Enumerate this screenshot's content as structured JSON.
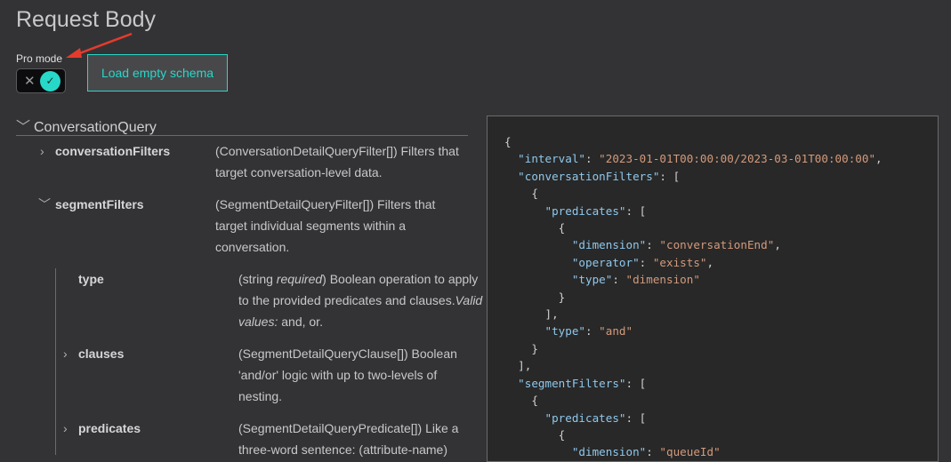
{
  "title": "Request Body",
  "pro_mode": {
    "label": "Pro mode",
    "enabled": true
  },
  "load_button": "Load empty schema",
  "colors": {
    "accent": "#27d8c8",
    "annotation_arrow": "#e53b2c"
  },
  "tree": {
    "root": "ConversationQuery",
    "rows": [
      {
        "name": "conversationFilters",
        "expanded": false,
        "desc": "(ConversationDetailQueryFilter[]) Filters that target conversation-level data."
      },
      {
        "name": "segmentFilters",
        "expanded": true,
        "desc": "(SegmentDetailQueryFilter[]) Filters that target individual segments within a conversation."
      }
    ],
    "children": [
      {
        "name": "type",
        "desc_pre": "(string ",
        "desc_em": "required",
        "desc_mid": ") Boolean operation to apply to the provided predicates and clauses.",
        "desc_em2": "Valid values:",
        "desc_post": " and, or."
      },
      {
        "name": "clauses",
        "desc": "(SegmentDetailQueryClause[]) Boolean 'and/or' logic with up to two-levels of nesting."
      },
      {
        "name": "predicates",
        "desc": "(SegmentDetailQueryPredicate[]) Like a three-word sentence: (attribute-name)"
      }
    ]
  },
  "code_lines": [
    {
      "i": 0,
      "t": [
        [
          "p",
          "{"
        ]
      ]
    },
    {
      "i": 1,
      "t": [
        [
          "k",
          "\"interval\""
        ],
        [
          "p",
          ": "
        ],
        [
          "s",
          "\"2023-01-01T00:00:00/2023-03-01T00:00:00\""
        ],
        [
          "p",
          ","
        ]
      ]
    },
    {
      "i": 1,
      "t": [
        [
          "k",
          "\"conversationFilters\""
        ],
        [
          "p",
          ": ["
        ]
      ]
    },
    {
      "i": 2,
      "t": [
        [
          "p",
          "{"
        ]
      ]
    },
    {
      "i": 3,
      "t": [
        [
          "k",
          "\"predicates\""
        ],
        [
          "p",
          ": ["
        ]
      ]
    },
    {
      "i": 4,
      "t": [
        [
          "p",
          "{"
        ]
      ]
    },
    {
      "i": 5,
      "t": [
        [
          "k",
          "\"dimension\""
        ],
        [
          "p",
          ": "
        ],
        [
          "s",
          "\"conversationEnd\""
        ],
        [
          "p",
          ","
        ]
      ]
    },
    {
      "i": 5,
      "t": [
        [
          "k",
          "\"operator\""
        ],
        [
          "p",
          ": "
        ],
        [
          "s",
          "\"exists\""
        ],
        [
          "p",
          ","
        ]
      ]
    },
    {
      "i": 5,
      "t": [
        [
          "k",
          "\"type\""
        ],
        [
          "p",
          ": "
        ],
        [
          "s",
          "\"dimension\""
        ]
      ]
    },
    {
      "i": 4,
      "t": [
        [
          "p",
          "}"
        ]
      ]
    },
    {
      "i": 3,
      "t": [
        [
          "p",
          "],"
        ]
      ]
    },
    {
      "i": 3,
      "t": [
        [
          "k",
          "\"type\""
        ],
        [
          "p",
          ": "
        ],
        [
          "s",
          "\"and\""
        ]
      ]
    },
    {
      "i": 2,
      "t": [
        [
          "p",
          "}"
        ]
      ]
    },
    {
      "i": 1,
      "t": [
        [
          "p",
          "],"
        ]
      ]
    },
    {
      "i": 1,
      "t": [
        [
          "k",
          "\"segmentFilters\""
        ],
        [
          "p",
          ": ["
        ]
      ]
    },
    {
      "i": 2,
      "t": [
        [
          "p",
          "{"
        ]
      ]
    },
    {
      "i": 3,
      "t": [
        [
          "k",
          "\"predicates\""
        ],
        [
          "p",
          ": ["
        ]
      ]
    },
    {
      "i": 4,
      "t": [
        [
          "p",
          "{"
        ]
      ]
    },
    {
      "i": 5,
      "t": [
        [
          "k",
          "\"dimension\""
        ],
        [
          "p",
          ": "
        ],
        [
          "s",
          "\"queueId\""
        ]
      ]
    }
  ]
}
